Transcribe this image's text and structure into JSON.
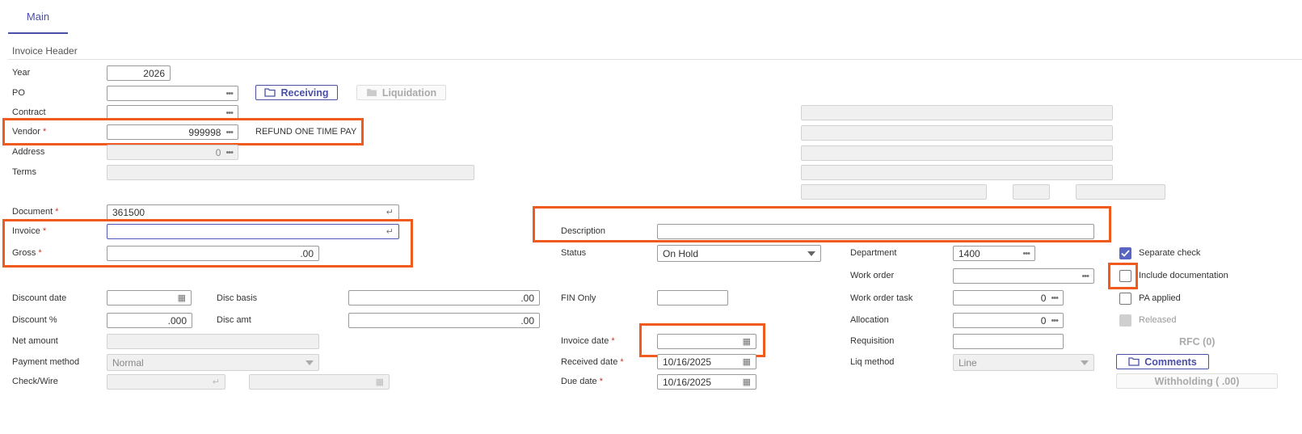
{
  "tabs": {
    "main": "Main"
  },
  "section_title": "Invoice Header",
  "fields": {
    "year": {
      "label": "Year",
      "value": "2026"
    },
    "po": {
      "label": "PO",
      "value": ""
    },
    "receiving_button": "Receiving",
    "liquidation_button": "Liquidation",
    "contract": {
      "label": "Contract",
      "value": ""
    },
    "vendor": {
      "label": "Vendor",
      "value": "999998",
      "name": "REFUND ONE TIME PAY"
    },
    "address": {
      "label": "Address",
      "value": "0"
    },
    "terms": {
      "label": "Terms",
      "value": ""
    },
    "document": {
      "label": "Document",
      "value": "361500"
    },
    "invoice": {
      "label": "Invoice",
      "value": ""
    },
    "gross": {
      "label": "Gross",
      "value": ".00"
    },
    "discount_date": {
      "label": "Discount date",
      "value": ""
    },
    "disc_basis": {
      "label": "Disc basis",
      "value": ".00"
    },
    "discount_pct": {
      "label": "Discount %",
      "value": ".000"
    },
    "disc_amt": {
      "label": "Disc amt",
      "value": ".00"
    },
    "net_amount": {
      "label": "Net amount",
      "value": ""
    },
    "payment_method": {
      "label": "Payment method",
      "value": "Normal"
    },
    "check_wire": {
      "label": "Check/Wire",
      "value": ""
    },
    "description": {
      "label": "Description",
      "value": ""
    },
    "status": {
      "label": "Status",
      "value": "On Hold"
    },
    "fin_only": {
      "label": "FIN Only",
      "value": ""
    },
    "invoice_date": {
      "label": "Invoice date",
      "value": ""
    },
    "received_date": {
      "label": "Received date",
      "value": "10/16/2025"
    },
    "due_date": {
      "label": "Due date",
      "value": "10/16/2025"
    },
    "department": {
      "label": "Department",
      "value": "1400"
    },
    "work_order": {
      "label": "Work order",
      "value": ""
    },
    "work_order_task": {
      "label": "Work order task",
      "value": "0"
    },
    "allocation": {
      "label": "Allocation",
      "value": "0"
    },
    "requisition": {
      "label": "Requisition",
      "value": ""
    },
    "liq_method": {
      "label": "Liq method",
      "value": "Line"
    }
  },
  "checks": {
    "separate_check": {
      "label": "Separate check",
      "checked": true
    },
    "include_documentation": {
      "label": "Include documentation",
      "checked": false
    },
    "pa_applied": {
      "label": "PA applied",
      "checked": false
    },
    "released": {
      "label": "Released"
    }
  },
  "rfc_label": "RFC (0)",
  "comments_button": "Comments",
  "withholding_button": "Withholding ( .00)",
  "required_mark": "*",
  "highlight_color": "#f15a1f",
  "accent_color": "#4a4fa8"
}
